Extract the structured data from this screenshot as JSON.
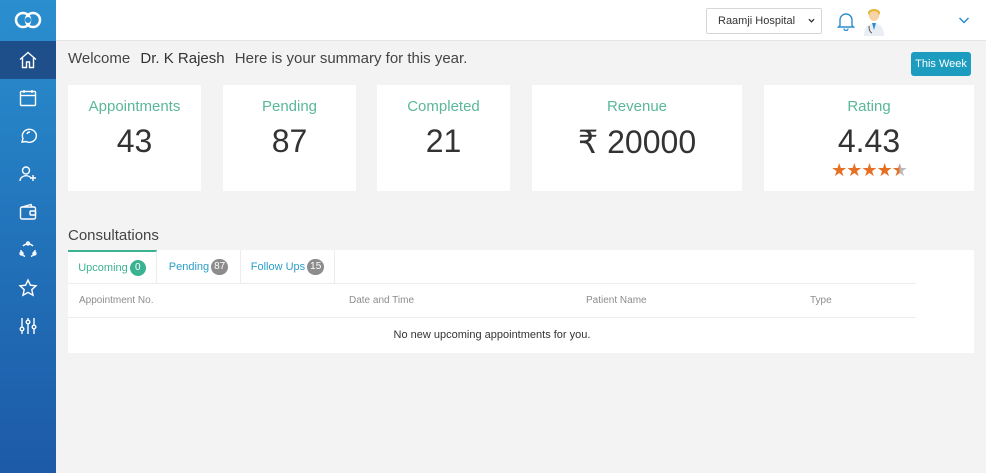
{
  "colors": {
    "sidebar_top": "#2a8fcf",
    "sidebar_bottom": "#1d5aa8",
    "accent_green": "#5ab79a",
    "button_blue": "#1c9dbf",
    "star_orange": "#e76f24"
  },
  "sidebar": {
    "logo_icon": "infinity-logo-icon",
    "items": [
      {
        "icon": "home-icon",
        "active": true
      },
      {
        "icon": "calendar-icon",
        "active": false
      },
      {
        "icon": "chat-icon",
        "active": false
      },
      {
        "icon": "add-user-icon",
        "active": false
      },
      {
        "icon": "wallet-icon",
        "active": false
      },
      {
        "icon": "refresh-cycle-icon",
        "active": false
      },
      {
        "icon": "star-badge-icon",
        "active": false
      },
      {
        "icon": "sliders-icon",
        "active": false
      }
    ]
  },
  "header": {
    "hospital": "Raamji Hospital",
    "notification_icon": "bell-icon",
    "avatar_icon": "doctor-avatar-icon",
    "menu_icon": "chevron-down-icon"
  },
  "welcome": {
    "prefix": "Welcome",
    "doctor": "Dr. K Rajesh",
    "suffix": "Here is your summary for this year.",
    "period_button": "This Week"
  },
  "stats": {
    "appointments": {
      "label": "Appointments",
      "value": "43"
    },
    "pending": {
      "label": "Pending",
      "value": "87"
    },
    "completed": {
      "label": "Completed",
      "value": "21"
    },
    "revenue": {
      "label": "Revenue",
      "value": "₹ 20000"
    },
    "rating": {
      "label": "Rating",
      "value": "4.43",
      "stars": 4.5,
      "max_stars": 5
    }
  },
  "consultations": {
    "title": "Consultations",
    "tabs": [
      {
        "label": "Upcoming",
        "count": "0"
      },
      {
        "label": "Pending",
        "count": "87"
      },
      {
        "label": "Follow Ups",
        "count": "15"
      }
    ],
    "columns": [
      "Appointment No.",
      "Date and Time",
      "Patient Name",
      "Type"
    ],
    "empty_message": "No new upcoming appointments for you."
  }
}
